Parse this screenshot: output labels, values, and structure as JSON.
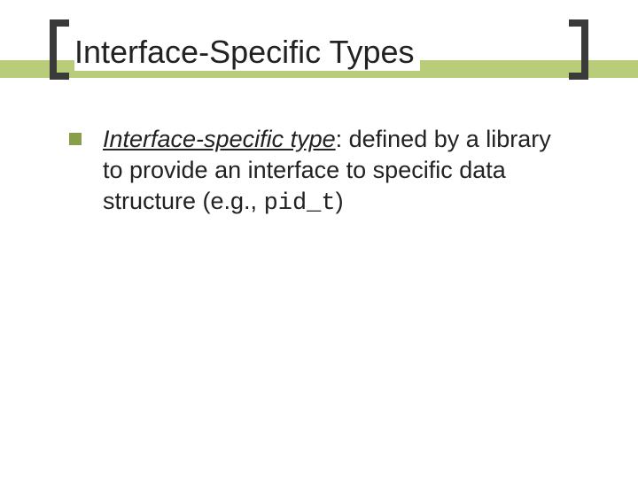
{
  "title": "Interface-Specific Types",
  "bullet": {
    "term": "Interface-specific type",
    "text_part1": ":  defined by a library to provide an interface to specific data structure (e.g., ",
    "code": "pid_t",
    "text_part2": ")"
  }
}
